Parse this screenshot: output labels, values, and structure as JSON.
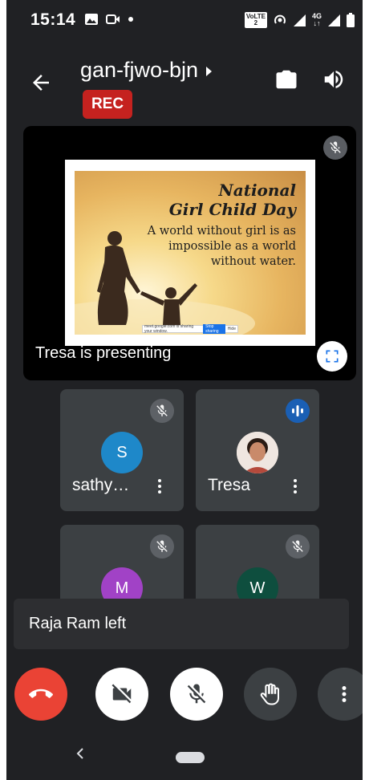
{
  "status_bar": {
    "time": "15:14",
    "volte_label": "VoLTE",
    "volte_sim": "2",
    "network_type": "4G"
  },
  "header": {
    "meeting_code": "gan-fjwo-bjn",
    "rec_label": "REC"
  },
  "presentation": {
    "slide_title_line1": "National",
    "slide_title_line2": "Girl Child Day",
    "slide_body": "A world without girl is as impossible as a world without water.",
    "share_bar_text": "meet.google.com is sharing your window.",
    "share_bar_button": "Stop sharing",
    "share_bar_hide": "Hide",
    "caption": "Tresa is presenting"
  },
  "participants": [
    {
      "initial": "S",
      "name": "sathy…",
      "avatar_color": "#1e88c9",
      "muted": true
    },
    {
      "initial": "",
      "name": "Tresa",
      "avatar_color": "#d9a38e",
      "muted": false,
      "speaking": true
    },
    {
      "initial": "M",
      "name": "",
      "avatar_color": "#a142c6",
      "muted": true
    },
    {
      "initial": "W",
      "name": "",
      "avatar_color": "#0e4e3e",
      "muted": true
    }
  ],
  "toast": {
    "message": "Raja Ram left"
  },
  "colors": {
    "background": "#202124",
    "tile": "#3c4043",
    "end_call": "#ea4335",
    "rec": "#c5221f"
  },
  "icons": {
    "back": "arrow-left-icon",
    "switch_camera": "switch-camera-icon",
    "speaker": "volume-icon",
    "end_call": "phone-hangup-icon",
    "camera": "video-off-icon",
    "mic": "mic-off-icon",
    "hand": "raise-hand-icon",
    "more": "more-vert-icon"
  }
}
